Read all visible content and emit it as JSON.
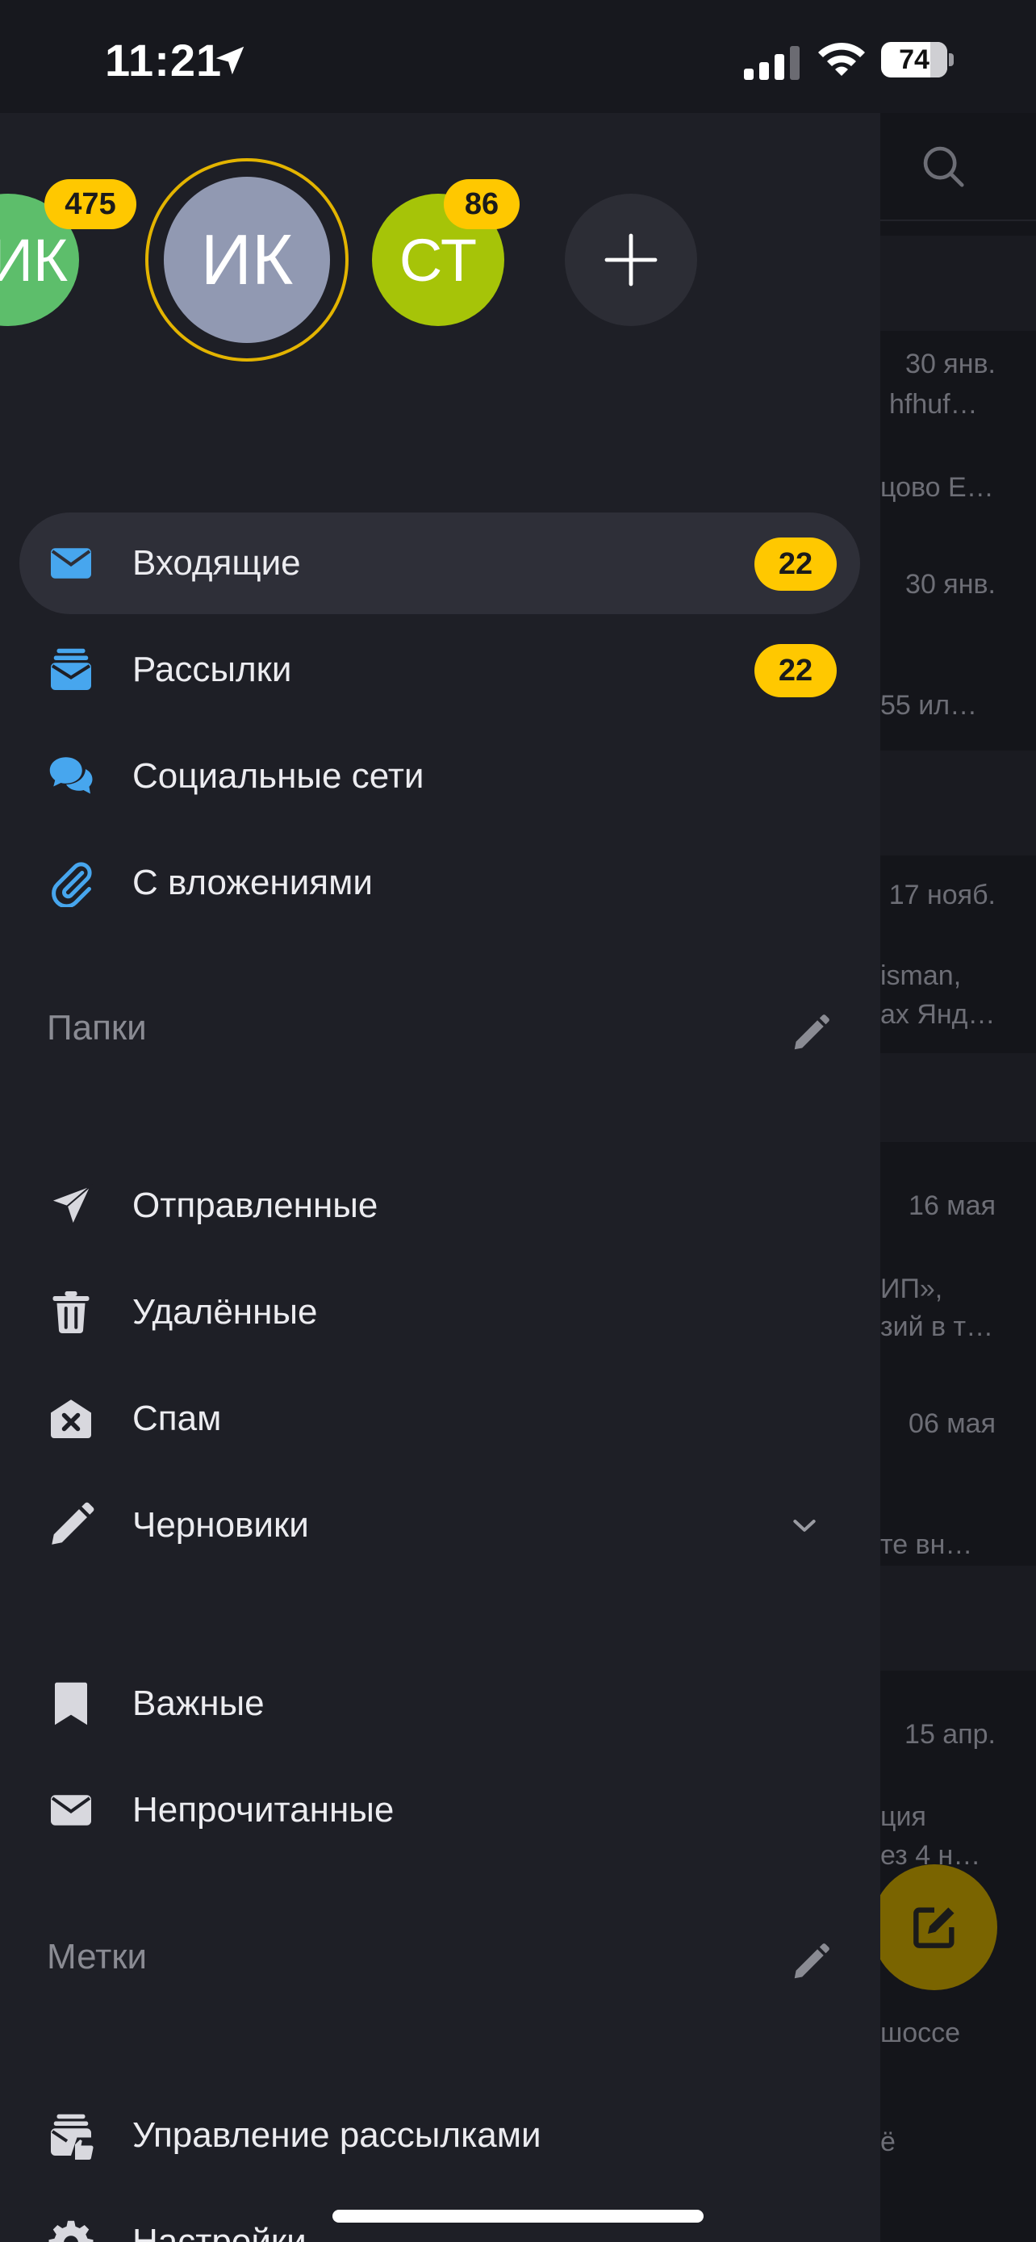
{
  "status_bar": {
    "time": "11:21",
    "battery": "74",
    "battery_level": 0.74
  },
  "accounts": [
    {
      "initials": "ИК",
      "color": "#5dbe6b",
      "badge": "475"
    },
    {
      "initials": "ИК",
      "color": "#9199b2",
      "selected": true,
      "ring_color": "#e3b400"
    },
    {
      "initials": "СТ",
      "color": "#a6c408",
      "badge": "86"
    },
    {
      "icon": "plus-icon"
    }
  ],
  "main_items": [
    {
      "label": "Входящие",
      "count": "22",
      "icon": "envelope-icon",
      "active": true
    },
    {
      "label": "Рассылки",
      "count": "22",
      "icon": "newsletter-icon"
    },
    {
      "label": "Социальные сети",
      "icon": "chat-bubbles-icon"
    },
    {
      "label": "С вложениями",
      "icon": "paperclip-icon"
    }
  ],
  "folders_section": {
    "title": "Папки",
    "edit_icon": "pencil-icon"
  },
  "folder_items": [
    {
      "label": "Отправленные",
      "icon": "paper-plane-icon"
    },
    {
      "label": "Удалённые",
      "icon": "trash-icon"
    },
    {
      "label": "Спам",
      "icon": "spam-icon"
    },
    {
      "label": "Черновики",
      "icon": "pencil-icon",
      "chevron": "chevron-down-icon"
    }
  ],
  "filter_items": [
    {
      "label": "Важные",
      "icon": "bookmark-icon"
    },
    {
      "label": "Непрочитанные",
      "icon": "envelope-icon"
    }
  ],
  "labels_section": {
    "title": "Метки",
    "edit_icon": "pencil-icon"
  },
  "bottom_items": [
    {
      "label": "Управление рассылками",
      "icon": "manage-subscriptions-icon"
    },
    {
      "label": "Настройки",
      "icon": "gear-icon"
    }
  ],
  "background_list": {
    "search_icon": "search-icon",
    "snippets": [
      "30 янв.",
      "hfhuf…",
      "цово Е…",
      "30 янв.",
      "55 ил…",
      "17 нояб.",
      "isman,",
      "ах Янд…",
      "16 мая",
      "ИП»,",
      "зий в т…",
      "06 мая",
      "те вн…",
      "15 апр.",
      "ция",
      "ез 4 н…",
      "шоссе",
      "ё"
    ],
    "compose_icon": "compose-icon"
  },
  "colors": {
    "accent": "#ffc800",
    "icon_blue": "#47a6ee",
    "drawer_bg": "#1e1f26"
  }
}
